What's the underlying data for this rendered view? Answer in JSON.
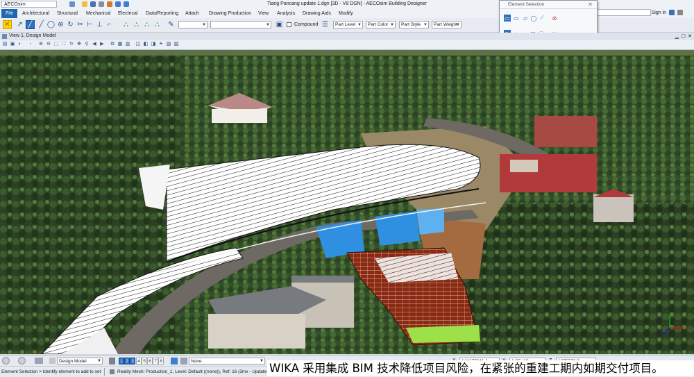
{
  "window": {
    "title": "Tiang Pancang update 1.dgn [3D - V8 DGN] - AECOsim Building Designer",
    "workspace": "AECOsim"
  },
  "ribbon": {
    "tabs": [
      "File",
      "Architectural",
      "Structural",
      "Mechanical",
      "Electrical",
      "Data/Reporting",
      "Attach",
      "Drawing Production",
      "View",
      "Analysis",
      "Drawing Aids",
      "Modify"
    ],
    "active_tab": "File",
    "search_placeholder": "Ribbon (F4)",
    "sign_in": "Sign in"
  },
  "toolbar": {
    "compound_label": "Compound",
    "part_level": "Part Level",
    "part_color": "Part Color",
    "part_style": "Part Style",
    "part_weight": "Part Weight"
  },
  "element_selection": {
    "title": "Element Selection"
  },
  "view": {
    "title": "View 1, Design Model"
  },
  "status": {
    "model": "Design Model",
    "view_numbers": [
      "1",
      "2",
      "3",
      "4",
      "5",
      "6",
      "7",
      "8"
    ],
    "active_views": [
      "1",
      "2",
      "3"
    ],
    "level": "None",
    "x_label": "X",
    "x_value": "144177241.1",
    "y_label": "Y",
    "y_value": "1.9E+10",
    "z_label": "Z",
    "z_value": "1375573.9",
    "prompt": "Element Selection > Identify element to add to set",
    "info": "Reality Mesh: Production_1, Level: Default ((none)), Ref: 16 (3mx - Update.dgn)"
  },
  "caption": "WIKA 采用集成 BIM 技术降低项目风险，在紧张的重建工期内如期交付项目。",
  "colors": {
    "accent": "#1f67b1",
    "foliage": "#3d5a2c",
    "road": "#6e6a63",
    "slope_wall": "#ffffff",
    "retaining_wall": "#8a2a12",
    "tarp": "#2f8fe0",
    "roof": "#b23a3a"
  }
}
